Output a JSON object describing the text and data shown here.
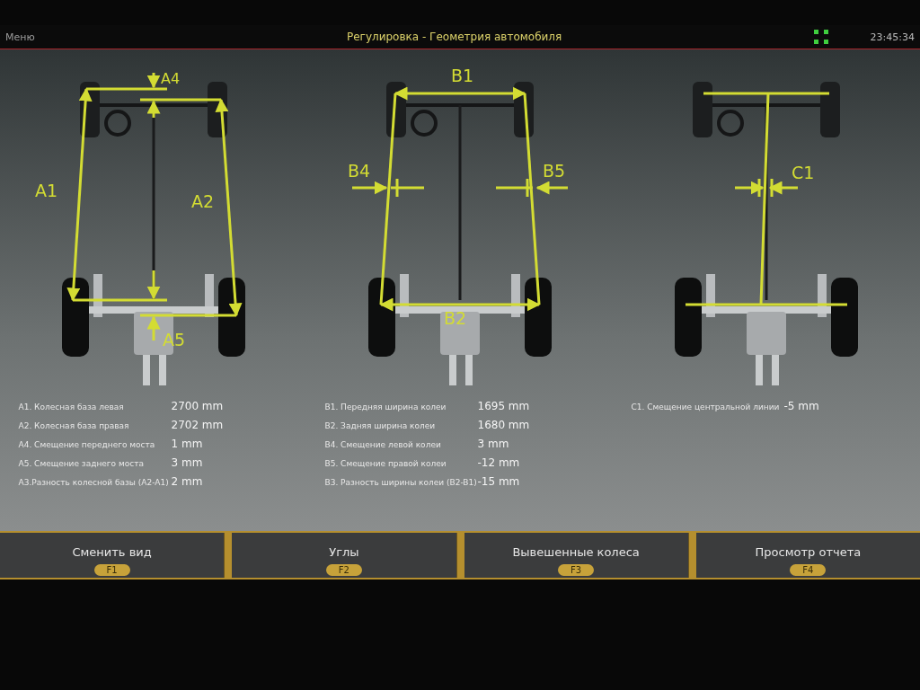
{
  "header": {
    "menu": "Меню",
    "title": "Регулировка - Геометрия автомобиля",
    "time": "23:45:34"
  },
  "views": [
    {
      "kind": "wheelbase",
      "labels": [
        "A4",
        "A1",
        "A2",
        "A5"
      ],
      "measurements": [
        {
          "label": "A1. Колесная база левая",
          "value": "2700 mm"
        },
        {
          "label": "A2. Колесная база правая",
          "value": "2702 mm"
        },
        {
          "label": "A4. Смещение переднего моста",
          "value": "1 mm"
        },
        {
          "label": "A5. Смещение заднего моста",
          "value": "3 mm"
        },
        {
          "label": "A3.Разность колесной базы (A2-A1)",
          "value": "2 mm"
        }
      ]
    },
    {
      "kind": "track",
      "labels": [
        "B1",
        "B4",
        "B5",
        "B2"
      ],
      "measurements": [
        {
          "label": "B1. Передняя ширина колеи",
          "value": "1695 mm"
        },
        {
          "label": "B2. Задняя ширина колеи",
          "value": "1680 mm"
        },
        {
          "label": "B4. Смещение левой колеи",
          "value": "3 mm"
        },
        {
          "label": "B5. Смещение правой колеи",
          "value": "-12 mm"
        },
        {
          "label": "B3. Разность ширины колеи (B2-B1)",
          "value": "-15 mm"
        }
      ]
    },
    {
      "kind": "centerline",
      "labels": [
        "C1"
      ],
      "measurements": [
        {
          "label": "C1. Смещение центральной линии",
          "value": "-5 mm"
        }
      ]
    }
  ],
  "footer": [
    {
      "label": "Сменить вид",
      "key": "F1"
    },
    {
      "label": "Углы",
      "key": "F2"
    },
    {
      "label": "Вывешенные колеса",
      "key": "F3"
    },
    {
      "label": "Просмотр отчета",
      "key": "F4"
    }
  ]
}
